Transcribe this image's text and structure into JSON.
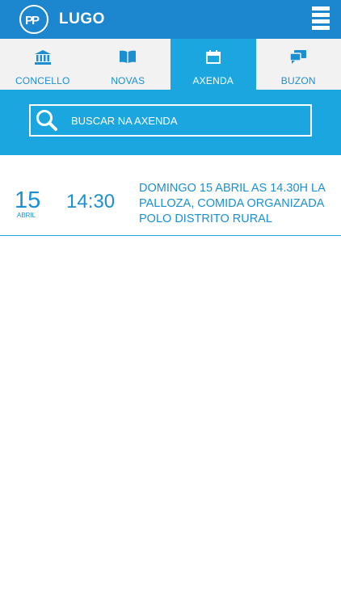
{
  "header": {
    "title": "LUGO",
    "logo_icon": "party-logo-icon",
    "menu_icon": "hamburger-menu-icon"
  },
  "tabs": [
    {
      "label": "CONCELLO",
      "icon": "bank-building-icon",
      "active": false
    },
    {
      "label": "NOVAS",
      "icon": "open-book-icon",
      "active": false
    },
    {
      "label": "AXENDA",
      "icon": "calendar-icon",
      "active": true
    },
    {
      "label": "BUZON",
      "icon": "chat-bubbles-icon",
      "active": false
    }
  ],
  "search": {
    "placeholder": "BUSCAR NA AXENDA",
    "value": "",
    "icon": "search-icon"
  },
  "events": [
    {
      "day": "15",
      "month": "ABRIL",
      "time": "14:30",
      "description": "DOMINGO 15 ABRIL AS 14.30H LA PALLOZA, COMIDA ORGANIZADA POLO DISTRITO RURAL"
    }
  ],
  "colors": {
    "header_bg": "#1c86cf",
    "accent": "#1ca6e0",
    "text_blue": "#1c8fd2",
    "tab_bg": "#f2f2f2"
  }
}
